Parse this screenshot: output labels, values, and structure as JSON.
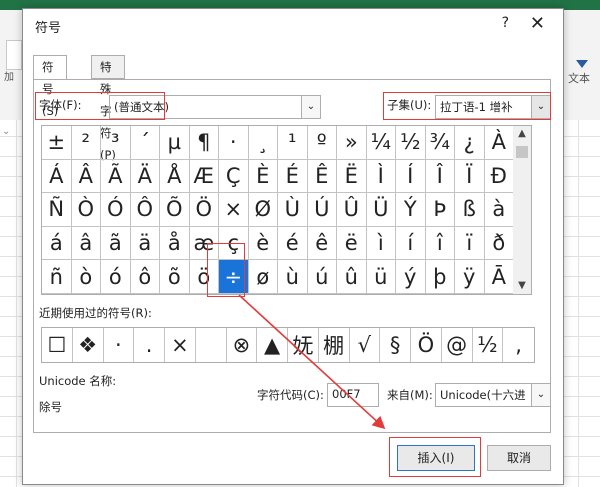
{
  "window": {
    "title": "符号"
  },
  "tabs": [
    {
      "label": "符号(S)"
    },
    {
      "label": "特殊字符(P)"
    }
  ],
  "controls": {
    "font_label": "字体(F):",
    "font_value": "(普通文本)",
    "subset_label": "子集(U):",
    "subset_value": "拉丁语-1 增补"
  },
  "symbols": [
    "±",
    "²",
    "³",
    "´",
    "µ",
    "¶",
    "·",
    "¸",
    "¹",
    "º",
    "»",
    "¼",
    "½",
    "¾",
    "¿",
    "À",
    "Á",
    "Â",
    "Ã",
    "Ä",
    "Å",
    "Æ",
    "Ç",
    "È",
    "É",
    "Ê",
    "Ë",
    "Ì",
    "Í",
    "Î",
    "Ï",
    "Ð",
    "Ñ",
    "Ò",
    "Ó",
    "Ô",
    "Õ",
    "Ö",
    "×",
    "Ø",
    "Ù",
    "Ú",
    "Û",
    "Ü",
    "Ý",
    "Þ",
    "ß",
    "à",
    "á",
    "â",
    "ã",
    "ä",
    "å",
    "æ",
    "ç",
    "è",
    "é",
    "ê",
    "ë",
    "ì",
    "í",
    "î",
    "ï",
    "ð",
    "ñ",
    "ò",
    "ó",
    "ô",
    "õ",
    "ö",
    "÷",
    "ø",
    "ù",
    "ú",
    "û",
    "ü",
    "ý",
    "þ",
    "ÿ",
    "Ā"
  ],
  "selected_index": 70,
  "recent": {
    "label": "近期使用过的符号(R):",
    "items": [
      "☐",
      "❖",
      "·",
      ".",
      "×",
      " ",
      "⊗",
      "▲",
      "妩",
      "棚",
      "√",
      "§",
      "Ö",
      "@",
      "½",
      ","
    ]
  },
  "info": {
    "unicode_name_label": "Unicode 名称:",
    "unicode_name_value": "除号",
    "char_code_label": "字符代码(C):",
    "char_code_value": "00F7",
    "from_label": "来自(M):",
    "from_value": "Unicode(十六进"
  },
  "buttons": {
    "insert": "插入(I)",
    "cancel": "取消"
  },
  "background": {
    "ribbon_left_label": "加",
    "ribbon_right_label": "文本"
  },
  "colors": {
    "selected": "#1a73d9",
    "highlight": "#e23b3b",
    "ribbon": "#217346"
  }
}
